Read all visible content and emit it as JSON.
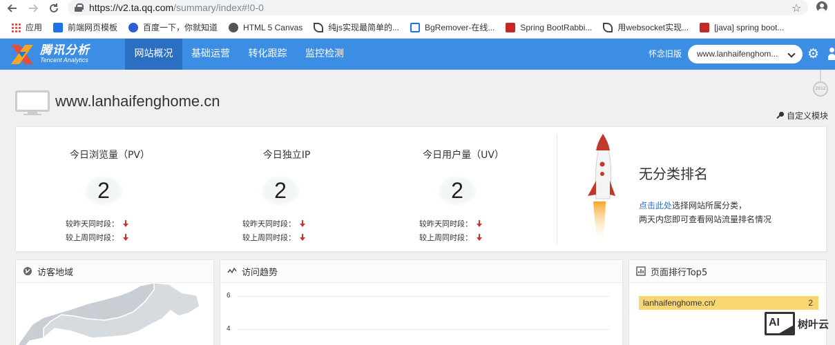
{
  "browser": {
    "url_host": "https://v2.ta.qq.com",
    "url_path": "/summary/index#!0-0",
    "bookmarks": [
      {
        "label": "应用"
      },
      {
        "label": "前端网页模板"
      },
      {
        "label": "百度一下，你就知道"
      },
      {
        "label": "HTML 5 Canvas"
      },
      {
        "label": "纯js实现最简单的..."
      },
      {
        "label": "BgRemover-在线..."
      },
      {
        "label": "Spring BootRabbi..."
      },
      {
        "label": "用websocket实现..."
      },
      {
        "label": "[java] spring boot..."
      }
    ]
  },
  "topnav": {
    "brand_cn": "腾讯分析",
    "brand_en": "Tencent Analytics",
    "items": [
      {
        "label": "网站概况",
        "active": true
      },
      {
        "label": "基础运营",
        "active": false
      },
      {
        "label": "转化跟踪",
        "active": false
      },
      {
        "label": "监控检测",
        "active": false
      }
    ],
    "old_version": "怀念旧版",
    "site_select": "www.lanhaifenghom..."
  },
  "page": {
    "site_title": "www.lanhaifenghome.cn",
    "customize": "自定义模块",
    "badge": "2012"
  },
  "stats": [
    {
      "label": "今日浏览量（PV）",
      "value": "2",
      "cmp_yesterday": "较昨天同时段：",
      "cmp_lastweek": "较上周同时段："
    },
    {
      "label": "今日独立IP",
      "value": "2",
      "cmp_yesterday": "较昨天同时段：",
      "cmp_lastweek": "较上周同时段："
    },
    {
      "label": "今日用户量（UV）",
      "value": "2",
      "cmp_yesterday": "较昨天同时段：",
      "cmp_lastweek": "较上周同时段："
    }
  ],
  "ranking": {
    "title": "无分类排名",
    "link": "点击此处",
    "desc1": "选择网站所属分类，",
    "desc2": "两天内您即可查看网站流量排名情况"
  },
  "cards": {
    "region": {
      "title": "访客地域"
    },
    "trend": {
      "title": "访问趋势",
      "y_ticks": [
        "6",
        "4"
      ]
    },
    "top5": {
      "title": "页面排行Top5",
      "rows": [
        {
          "page": "lanhaifenghome.cn/",
          "count": "2"
        }
      ]
    }
  },
  "watermark": {
    "box": "AI",
    "text": "树叶云"
  },
  "colors": {
    "nav_blue": "#3c8ee5",
    "nav_active": "#2a6fc2",
    "highlight_bar": "#f8d773",
    "down_arrow": "#d32f2f"
  }
}
